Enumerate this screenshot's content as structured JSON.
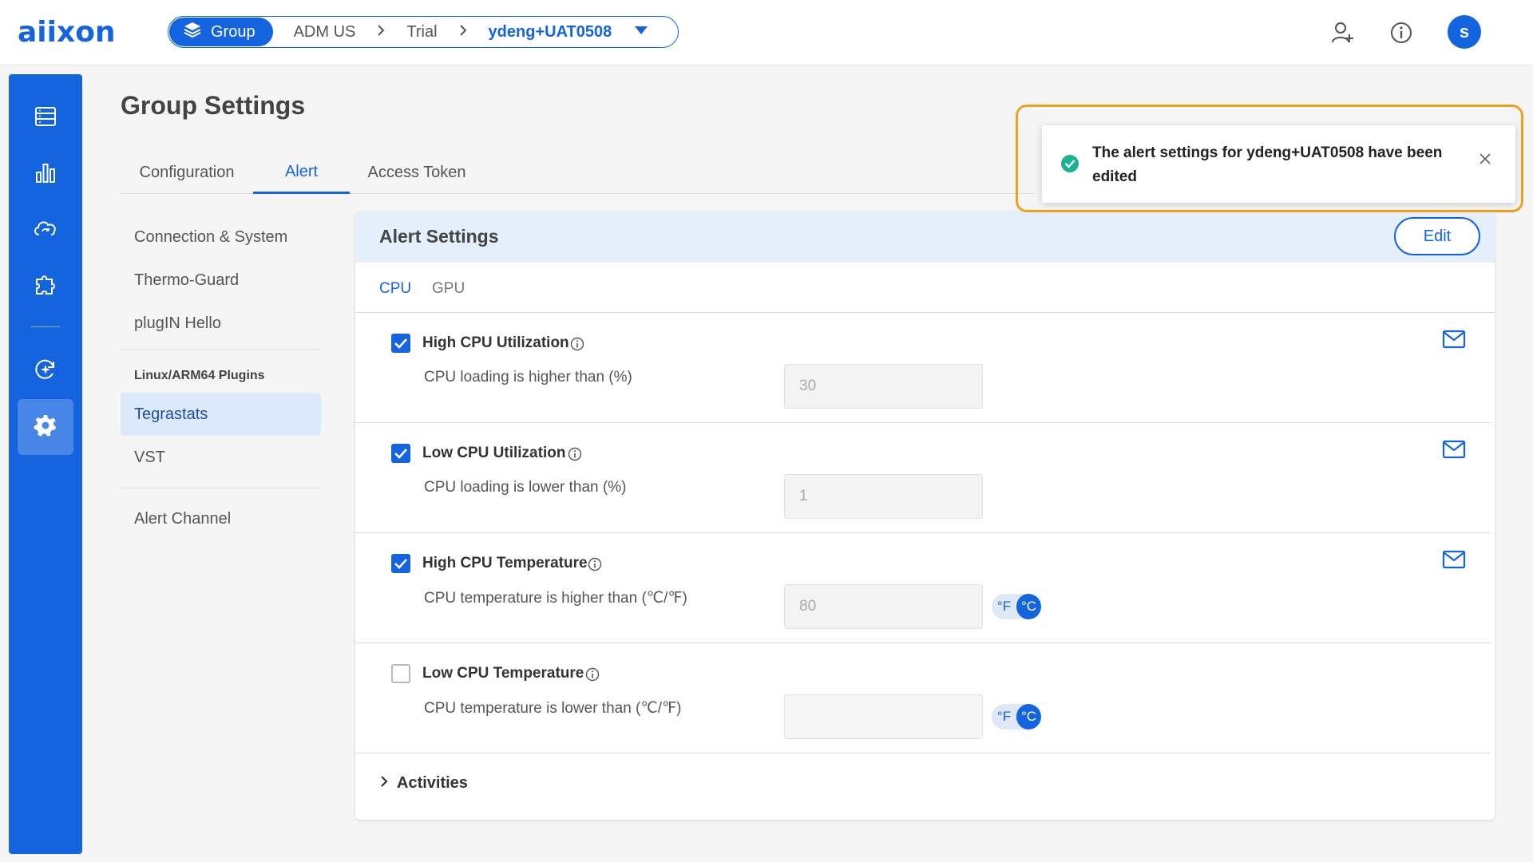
{
  "header": {
    "logo": "aiixon",
    "breadcrumb": {
      "group_label": "Group",
      "items": [
        "ADM US",
        "Trial"
      ],
      "current": "ydeng+UAT0508"
    },
    "avatar_initial": "s"
  },
  "page": {
    "title": "Group Settings",
    "tabs": [
      "Configuration",
      "Alert",
      "Access Token"
    ],
    "active_tab": "Alert"
  },
  "subnav": {
    "items_top": [
      "Connection & System",
      "Thermo-Guard",
      "plugIN Hello"
    ],
    "plugins_header": "Linux/ARM64 Plugins",
    "plugins": [
      "Tegrastats",
      "VST"
    ],
    "active": "Tegrastats",
    "bottom": [
      "Alert Channel"
    ]
  },
  "card": {
    "title": "Alert Settings",
    "edit_label": "Edit",
    "subtabs": [
      "CPU",
      "GPU"
    ],
    "active_subtab": "CPU",
    "rows": [
      {
        "label": "High CPU Utilization",
        "checked": true,
        "desc": "CPU loading is higher than (%)",
        "value": "30",
        "mail": true,
        "unit_toggle": false
      },
      {
        "label": "Low CPU Utilization",
        "checked": true,
        "desc": "CPU loading is lower than (%)",
        "value": "1",
        "mail": true,
        "unit_toggle": false
      },
      {
        "label": "High CPU Temperature",
        "checked": true,
        "desc": "CPU temperature is higher than (℃/℉)",
        "value": "80",
        "mail": true,
        "unit_toggle": true
      },
      {
        "label": "Low CPU Temperature",
        "checked": false,
        "desc": "CPU temperature is lower than (℃/℉)",
        "value": "",
        "mail": false,
        "unit_toggle": true
      }
    ],
    "unit_f": "°F",
    "unit_c": "°C",
    "activities_label": "Activities"
  },
  "toast": {
    "message": "The alert settings for ydeng+UAT0508 have been edited",
    "highlight_color": "#f0a020"
  },
  "colors": {
    "accent": "#1464e0",
    "success": "#19b394"
  }
}
